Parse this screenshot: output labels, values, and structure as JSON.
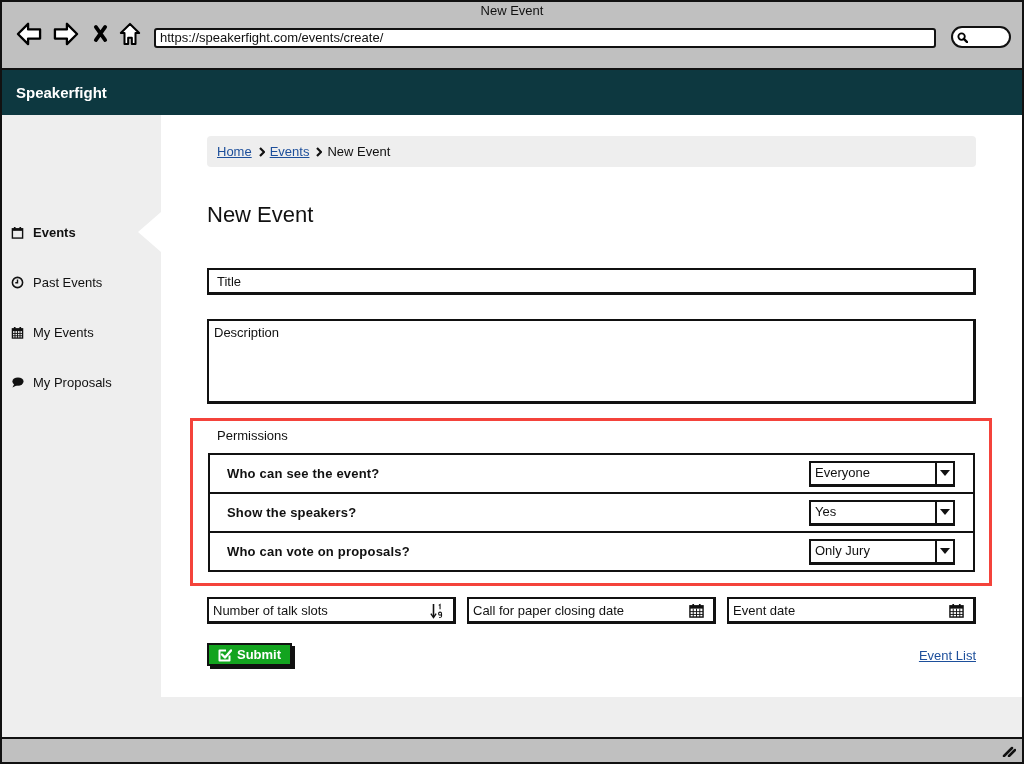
{
  "window": {
    "title": "New Event"
  },
  "browser": {
    "url": "https://speakerfight.com/events/create/"
  },
  "app_bar": {
    "brand": "Speakerfight"
  },
  "sidebar": {
    "items": [
      {
        "label": "Events",
        "selected": true
      },
      {
        "label": "Past Events",
        "selected": false
      },
      {
        "label": "My Events",
        "selected": false
      },
      {
        "label": "My Proposals",
        "selected": false
      }
    ]
  },
  "breadcrumb": [
    {
      "label": "Home",
      "kind": "link"
    },
    {
      "label": "Events",
      "kind": "link"
    },
    {
      "label": "New Event",
      "kind": "current"
    }
  ],
  "page_title": "New Event",
  "form": {
    "title_field": {
      "placeholder": "Title"
    },
    "description_field": {
      "placeholder": "Description"
    },
    "permissions": {
      "label": "Permissions",
      "highlighted": true,
      "rows": [
        {
          "question": "Who can see the event?",
          "value": "Everyone"
        },
        {
          "question": "Show the speakers?",
          "value": "Yes"
        },
        {
          "question": "Who can vote on proposals?",
          "value": "Only Jury"
        }
      ]
    },
    "fields": [
      {
        "placeholder": "Number of talk slots",
        "kind": "number"
      },
      {
        "placeholder": "Call for paper closing date",
        "kind": "date"
      },
      {
        "placeholder": "Event date",
        "kind": "date"
      }
    ],
    "submit_button": {
      "label": "Submit"
    },
    "link": {
      "label": "Event List"
    }
  }
}
